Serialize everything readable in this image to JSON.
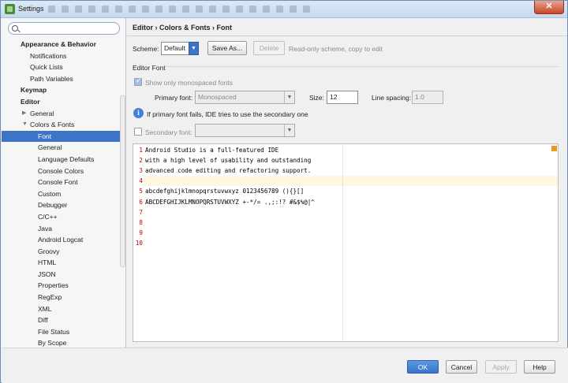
{
  "window": {
    "title": "Settings",
    "close_glyph": "✕"
  },
  "search": {
    "value": "",
    "placeholder": ""
  },
  "sidebar": {
    "items": [
      {
        "label": "Appearance & Behavior",
        "level": 0,
        "bold": true
      },
      {
        "label": "Notifications",
        "level": 1
      },
      {
        "label": "Quick Lists",
        "level": 1
      },
      {
        "label": "Path Variables",
        "level": 1
      },
      {
        "label": "Keymap",
        "level": 0,
        "bold": true
      },
      {
        "label": "Editor",
        "level": 0,
        "bold": true
      },
      {
        "label": "General",
        "level": 1,
        "arrow": "▶"
      },
      {
        "label": "Colors & Fonts",
        "level": 1,
        "arrow": "▼"
      },
      {
        "label": "Font",
        "level": 2,
        "selected": true
      },
      {
        "label": "General",
        "level": 2
      },
      {
        "label": "Language Defaults",
        "level": 2
      },
      {
        "label": "Console Colors",
        "level": 2
      },
      {
        "label": "Console Font",
        "level": 2
      },
      {
        "label": "Custom",
        "level": 2
      },
      {
        "label": "Debugger",
        "level": 2
      },
      {
        "label": "C/C++",
        "level": 2
      },
      {
        "label": "Java",
        "level": 2
      },
      {
        "label": "Android Logcat",
        "level": 2
      },
      {
        "label": "Groovy",
        "level": 2
      },
      {
        "label": "HTML",
        "level": 2
      },
      {
        "label": "JSON",
        "level": 2
      },
      {
        "label": "Properties",
        "level": 2
      },
      {
        "label": "RegExp",
        "level": 2
      },
      {
        "label": "XML",
        "level": 2
      },
      {
        "label": "Diff",
        "level": 2
      },
      {
        "label": "File Status",
        "level": 2
      },
      {
        "label": "By Scope",
        "level": 2
      }
    ]
  },
  "breadcrumb": "Editor › Colors & Fonts › Font",
  "scheme": {
    "label": "Scheme:",
    "value": "Default",
    "save_as": "Save As...",
    "delete": "Delete",
    "hint": "Read-only scheme, copy to edit"
  },
  "editor_font": {
    "group_label": "Editor Font",
    "show_mono_label": "Show only monospaced fonts",
    "primary_label": "Primary font:",
    "primary_value": "Monospaced",
    "size_label": "Size:",
    "size_value": "12",
    "spacing_label": "Line spacing:",
    "spacing_value": "1.0",
    "fallback_hint": "If primary font fails, IDE tries to use the secondary one",
    "secondary_label": "Secondary font:",
    "secondary_value": ""
  },
  "preview": {
    "lines": [
      {
        "num": "1",
        "text": "Android Studio is a full-featured IDE"
      },
      {
        "num": "2",
        "text": "with a high level of usability and outstanding"
      },
      {
        "num": "3",
        "text": "advanced code editing and refactoring support."
      },
      {
        "num": "4",
        "text": ""
      },
      {
        "num": "5",
        "text": "abcdefghijklmnopqrstuvwxyz 0123456789 (){}[]"
      },
      {
        "num": "6",
        "text": "ABCDEFGHIJKLMNOPQRSTUVWXYZ +-*/= .,;:!? #&$%@|^"
      },
      {
        "num": "7",
        "text": ""
      },
      {
        "num": "8",
        "text": ""
      },
      {
        "num": "9",
        "text": ""
      },
      {
        "num": "10",
        "text": ""
      }
    ]
  },
  "footer": {
    "ok": "OK",
    "cancel": "Cancel",
    "apply": "Apply",
    "help": "Help"
  },
  "colors": {
    "selection": "#3d74c7",
    "line_number": "#c00000",
    "accent_marker": "#e69a1e"
  }
}
